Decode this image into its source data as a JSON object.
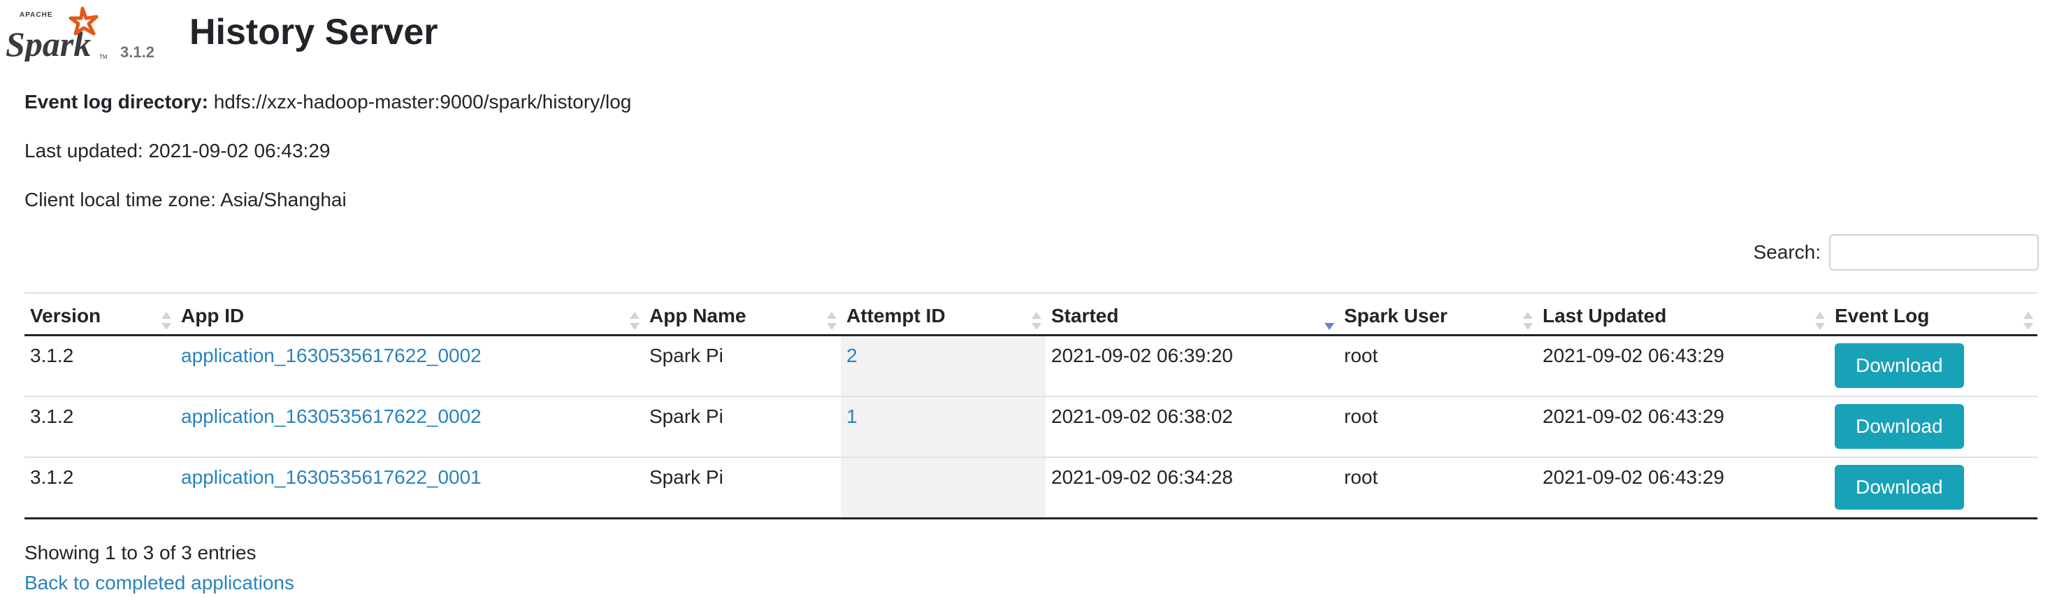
{
  "header": {
    "logo_alt": "Apache Spark",
    "version": "3.1.2",
    "title": "History Server"
  },
  "info": {
    "event_log_label": "Event log directory:",
    "event_log_value": "hdfs://xzx-hadoop-master:9000/spark/history/log",
    "last_updated": "Last updated: 2021-09-02 06:43:29",
    "timezone": "Client local time zone: Asia/Shanghai"
  },
  "search": {
    "label": "Search:",
    "value": "",
    "placeholder": ""
  },
  "table": {
    "columns": [
      "Version",
      "App ID",
      "App Name",
      "Attempt ID",
      "Started",
      "Spark User",
      "Last Updated",
      "Event Log"
    ],
    "sorted_column": "Started",
    "sort_direction": "descending",
    "rows": [
      {
        "version": "3.1.2",
        "app_id": "application_1630535617622_0002",
        "app_name": "Spark Pi",
        "attempt_id": "2",
        "started": "2021-09-02 06:39:20",
        "user": "root",
        "last_updated": "2021-09-02 06:43:29",
        "event_log": "Download"
      },
      {
        "version": "3.1.2",
        "app_id": "application_1630535617622_0002",
        "app_name": "Spark Pi",
        "attempt_id": "1",
        "started": "2021-09-02 06:38:02",
        "user": "root",
        "last_updated": "2021-09-02 06:43:29",
        "event_log": "Download"
      },
      {
        "version": "3.1.2",
        "app_id": "application_1630535617622_0001",
        "app_name": "Spark Pi",
        "attempt_id": "",
        "started": "2021-09-02 06:34:28",
        "user": "root",
        "last_updated": "2021-09-02 06:43:29",
        "event_log": "Download"
      }
    ]
  },
  "footer": {
    "entries_text": "Showing 1 to 3 of 3 entries",
    "back_link": "Back to completed applications"
  },
  "colors": {
    "link": "#2a83bd",
    "button": "#17a2b8",
    "sorted_column_bg": "#f2f2f2",
    "logo_orange": "#e25a1c",
    "sort_active": "#6b7fd8"
  },
  "icons": [
    "spark-logo",
    "sort-icon",
    "sort-desc-icon"
  ]
}
